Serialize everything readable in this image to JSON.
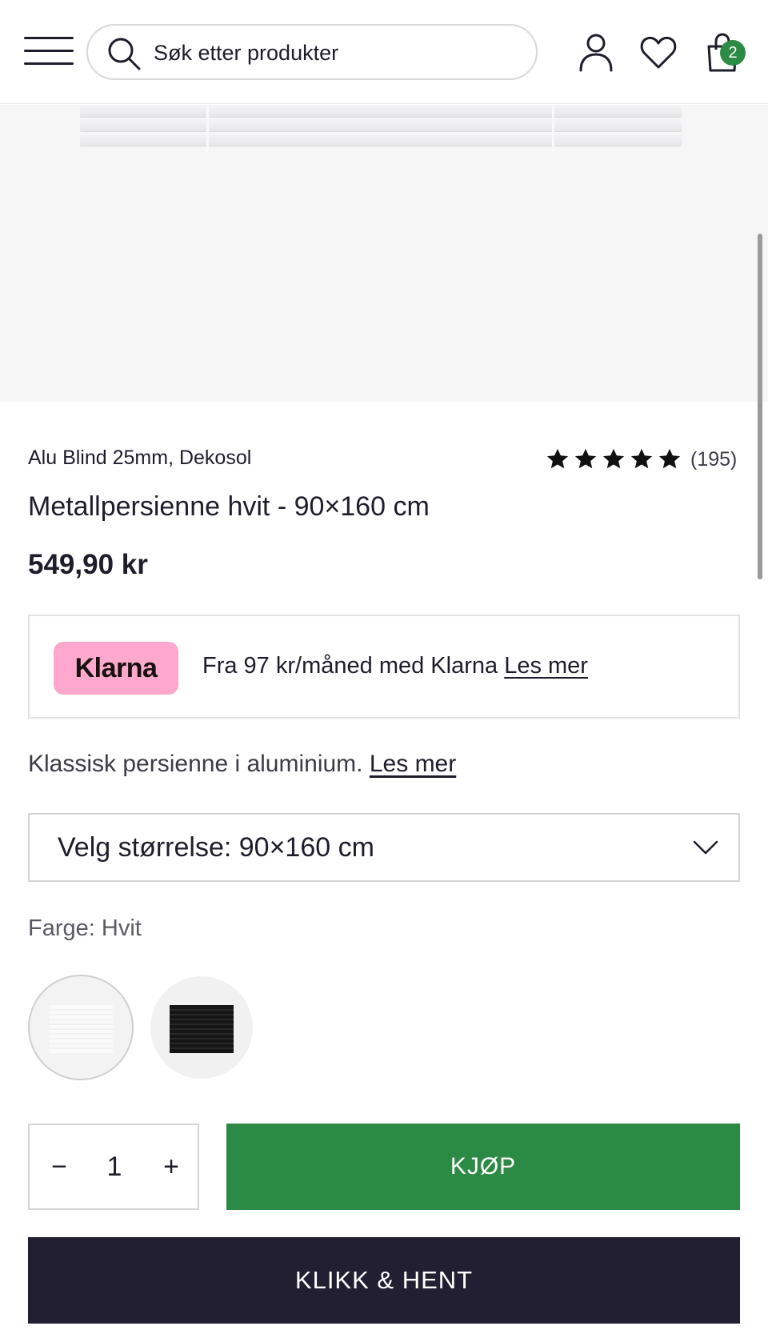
{
  "header": {
    "search_placeholder": "Søk etter produkter",
    "cart_count": "2"
  },
  "product": {
    "brand": "Alu Blind 25mm, Dekosol",
    "rating_stars": 5,
    "review_count": "(195)",
    "title": "Metallpersienne hvit - 90×160 cm",
    "price": "549,90 kr",
    "description": "Klassisk persienne i aluminium.",
    "description_link": "Les mer"
  },
  "klarna": {
    "logo": "Klarna",
    "text": "Fra 97 kr/måned med Klarna",
    "link": "Les mer",
    "logo_color": "#ffa8cd"
  },
  "size_select": {
    "label": "Velg størrelse: 90×160 cm"
  },
  "color": {
    "label": "Farge:",
    "value": "Hvit",
    "options": [
      "white",
      "black"
    ]
  },
  "purchase": {
    "quantity": "1",
    "minus": "−",
    "plus": "+",
    "buy_label": "KJØP",
    "click_collect_label": "KLIKK & HENT",
    "buy_color": "#2b8a43",
    "click_collect_color": "#231f32"
  }
}
